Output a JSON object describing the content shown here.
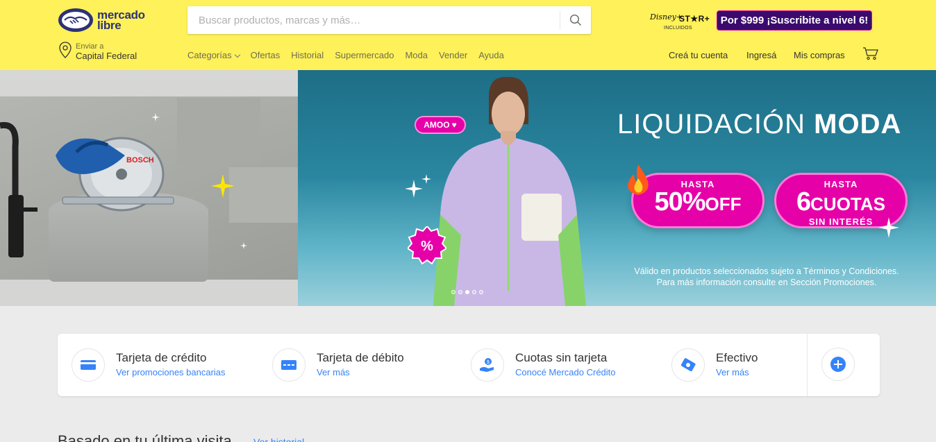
{
  "header": {
    "logo_line1": "mercado",
    "logo_line2": "libre",
    "search_placeholder": "Buscar productos, marcas y más…",
    "disney_brand": "Disney+",
    "star_brand": "ST★R+",
    "disney_included": "INCLUIDOS",
    "promo_text": "Por $999 ¡Suscribite a nivel 6!",
    "location_label": "Enviar a",
    "location_value": "Capital Federal",
    "nav": [
      "Categorías",
      "Ofertas",
      "Historial",
      "Supermercado",
      "Moda",
      "Vender",
      "Ayuda"
    ],
    "account": {
      "create": "Creá tu cuenta",
      "login": "Ingresá",
      "purchases": "Mis compras"
    }
  },
  "banner": {
    "title_light": "LIQUIDACIÓN",
    "title_bold": "MODA",
    "sticker": "AMOO",
    "offer1_small": "HASTA",
    "offer1_big": "50%",
    "offer1_suffix": "OFF",
    "offer2_small": "HASTA",
    "offer2_big": "6",
    "offer2_suffix": "CUOTAS",
    "offer2_bottom": "SIN INTERÉS",
    "badge": "%",
    "legal_line1": "Válido en productos seleccionados sujeto a Términos y Condiciones.",
    "legal_line2": "Para más información consulte en Sección Promociones.",
    "left_brand": "BOSCH",
    "slides_count": 5,
    "active_slide": 3
  },
  "payments": [
    {
      "title": "Tarjeta de crédito",
      "link": "Ver promociones bancarias",
      "icon": "credit-card-icon"
    },
    {
      "title": "Tarjeta de débito",
      "link": "Ver más",
      "icon": "debit-card-icon"
    },
    {
      "title": "Cuotas sin tarjeta",
      "link": "Conocé Mercado Crédito",
      "icon": "mercado-credito-icon"
    },
    {
      "title": "Efectivo",
      "link": "Ver más",
      "icon": "cash-icon"
    }
  ],
  "section": {
    "title": "Basado en tu última visita",
    "link": "Ver historial"
  },
  "colors": {
    "header_bg": "#fff159",
    "brand_blue": "#2d3277",
    "link_blue": "#3483fa",
    "promo_bg": "#3b0a6e",
    "offer_pink": "#e600a8"
  }
}
